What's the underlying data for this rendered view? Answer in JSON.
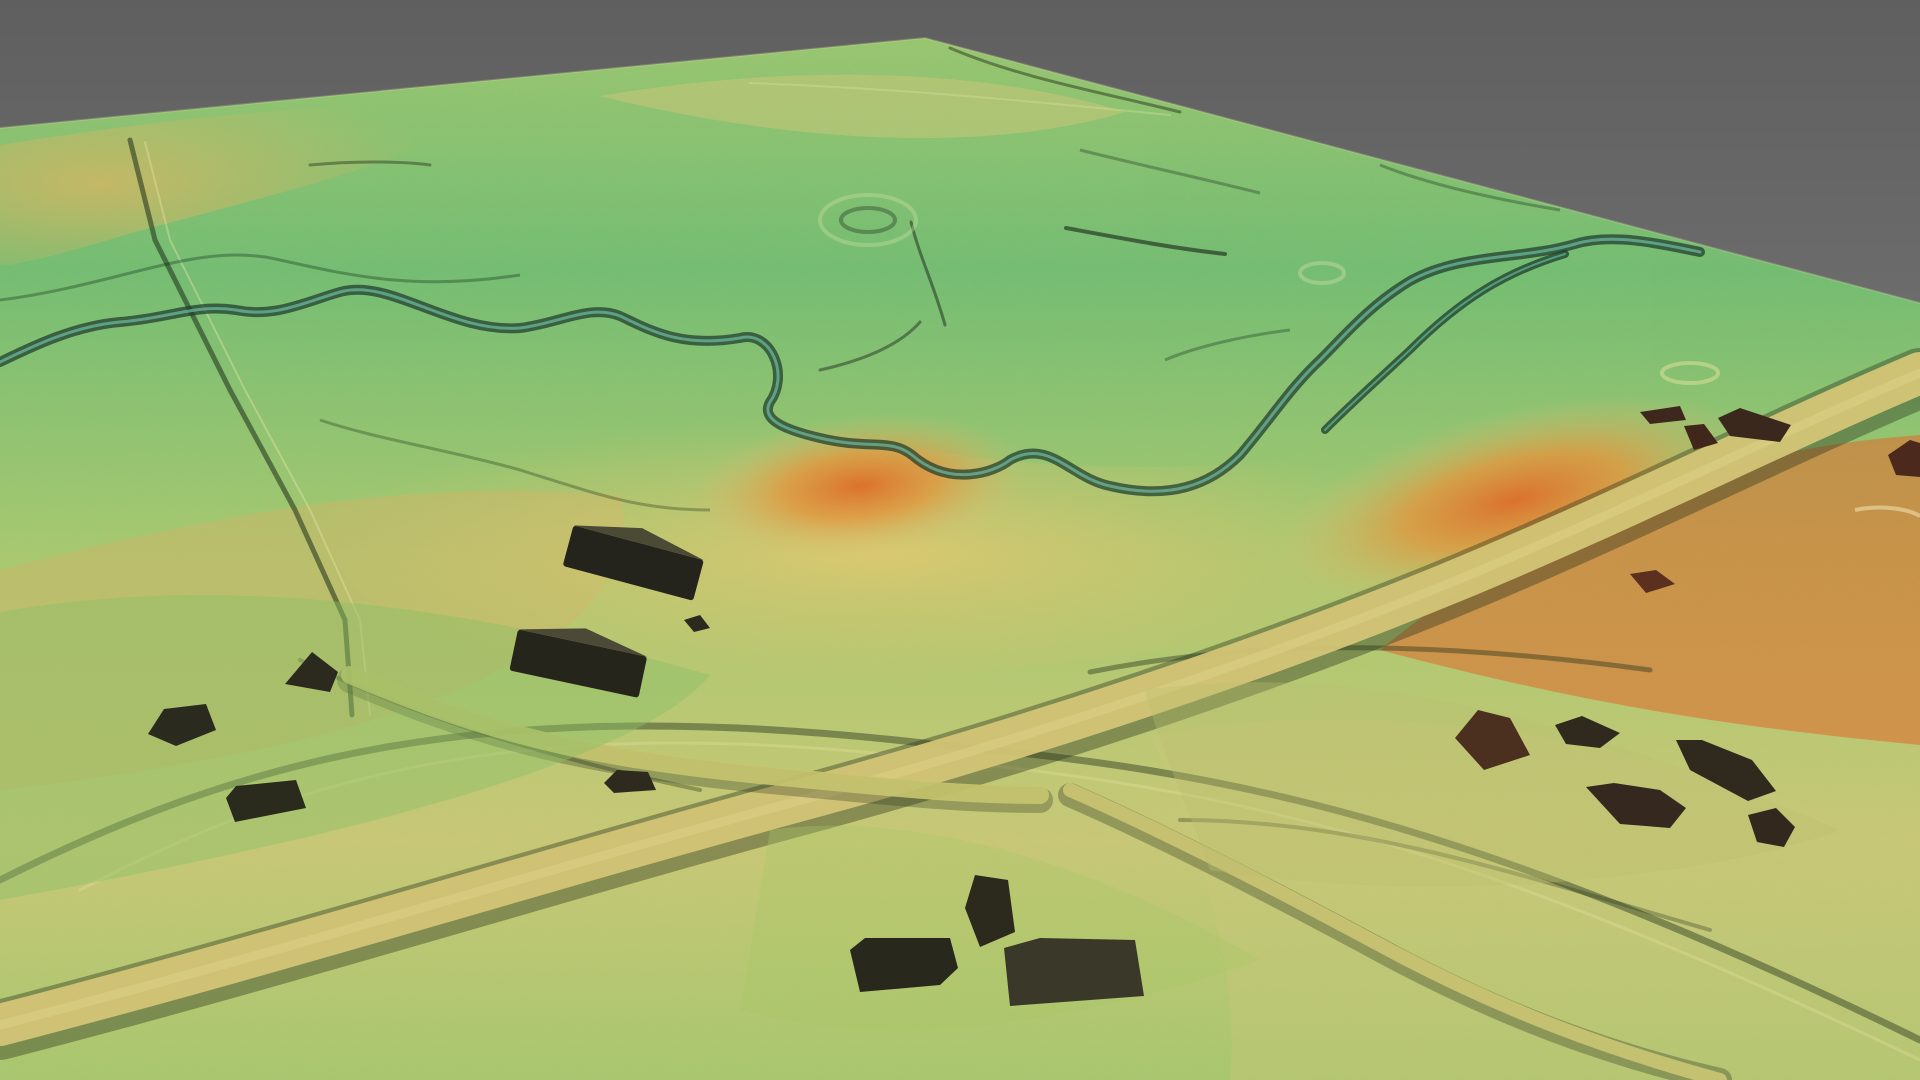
{
  "scene": {
    "kind": "lidar-3d-terrain-visualization",
    "colors": {
      "background_top": "#5f5f5f",
      "background_bottom": "#8d8d8d",
      "low_green": "#62b56a",
      "mid_green": "#92c760",
      "mid_yellow": "#d6c773",
      "high_orange": "#e47a2d",
      "highest_red": "#d44b1a",
      "shadow_dark": "#1f2b16",
      "building_dark": "#27261c"
    }
  }
}
